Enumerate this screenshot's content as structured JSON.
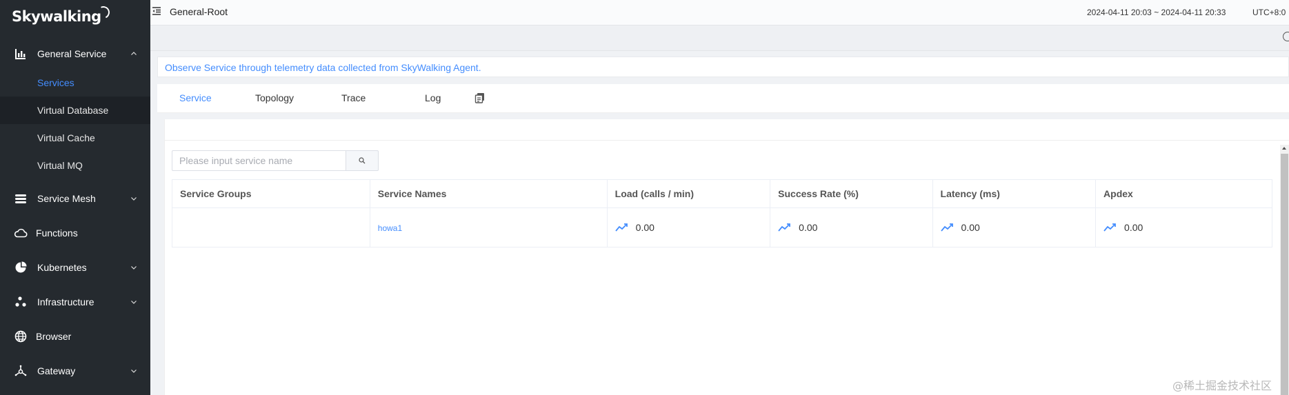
{
  "app": {
    "logo": "Skywalking"
  },
  "sidebar": {
    "groups": [
      {
        "label": "General Service",
        "icon": "bar-chart-icon",
        "expanded": true,
        "items": [
          {
            "label": "Services",
            "active": true
          },
          {
            "label": "Virtual Database"
          },
          {
            "label": "Virtual Cache"
          },
          {
            "label": "Virtual MQ"
          }
        ]
      },
      {
        "label": "Service Mesh",
        "icon": "layers-icon"
      },
      {
        "label": "Functions",
        "icon": "cloud-icon"
      },
      {
        "label": "Kubernetes",
        "icon": "pie-chart-icon"
      },
      {
        "label": "Infrastructure",
        "icon": "nodes-icon"
      },
      {
        "label": "Browser",
        "icon": "globe-icon"
      },
      {
        "label": "Gateway",
        "icon": "gateway-icon"
      }
    ]
  },
  "topbar": {
    "title": "General-Root",
    "time_range": "2024-04-11 20:03 ~ 2024-04-11 20:33",
    "timezone": "UTC+8:0"
  },
  "hint": "Observe Service through telemetry data collected from SkyWalking Agent.",
  "tabs": [
    "Service",
    "Topology",
    "Trace",
    "Log"
  ],
  "search": {
    "placeholder": "Please input service name"
  },
  "table": {
    "headers": [
      "Service Groups",
      "Service Names",
      "Load (calls / min)",
      "Success Rate (%)",
      "Latency (ms)",
      "Apdex"
    ],
    "rows": [
      {
        "group": "",
        "name": "howa1",
        "load": "0.00",
        "success_rate": "0.00",
        "latency": "0.00",
        "apdex": "0.00"
      }
    ]
  },
  "watermark": "@稀土掘金技术社区",
  "colors": {
    "accent": "#448dfe",
    "sidebar_bg": "#252a2f"
  }
}
